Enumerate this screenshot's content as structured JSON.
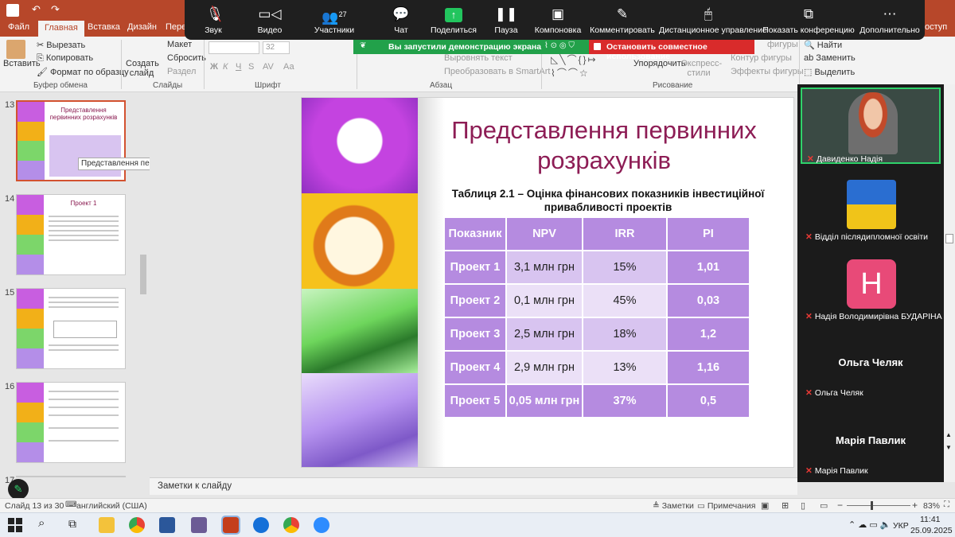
{
  "ribbon": {
    "tabs": [
      "Файл",
      "Главная",
      "Вставка",
      "Дизайн",
      "Пере",
      "оступ"
    ],
    "clipboard": {
      "paste": "Вставить",
      "cut": "Вырезать",
      "copy": "Копировать",
      "format": "Формат по образцу",
      "group": "Буфер обмена"
    },
    "slides": {
      "new": "Создать слайд",
      "layout": "Макет",
      "reset": "Сбросить",
      "section": "Раздел",
      "group": "Слайды"
    },
    "font": {
      "size": "32",
      "group": "Шрифт",
      "bold": "Ж",
      "italic": "К",
      "underline": "Ч",
      "strike": "З",
      "shadow": "S",
      "spacing": "AV",
      "case": "Аа"
    },
    "paragraph": {
      "align": "Выровнять текст",
      "smartart": "Преобразовать в SmartArt",
      "group": "Абзац"
    },
    "drawing": {
      "arrange": "Упорядочить",
      "styles": "Экспресс-стили",
      "outline": "Контур фигуры",
      "effects": "Эффекты фигуры",
      "fill": "фигуры",
      "group": "Рисование"
    },
    "editing": {
      "find": "Найти",
      "replace": "Заменить",
      "select": "Выделить"
    }
  },
  "zoom": {
    "buttons": [
      {
        "label": "Звук",
        "icon": "mic-muted-icon"
      },
      {
        "label": "Видео",
        "icon": "video-icon"
      },
      {
        "label": "Участники",
        "icon": "participants-icon",
        "count": "27"
      },
      {
        "label": "Чат",
        "icon": "chat-icon"
      },
      {
        "label": "Поделиться",
        "icon": "share-icon"
      },
      {
        "label": "Пауза",
        "icon": "pause-icon"
      },
      {
        "label": "Компоновка",
        "icon": "layout-icon"
      },
      {
        "label": "Комментировать",
        "icon": "pencil-icon"
      },
      {
        "label": "Дистанционное управление",
        "icon": "mouse-icon"
      },
      {
        "label": "Показать конференцию",
        "icon": "conference-icon"
      },
      {
        "label": "Дополнительно",
        "icon": "more-icon"
      }
    ],
    "share_banner": "Вы запустили демонстрацию экрана",
    "stop_banner": "Остановить совместное использование"
  },
  "thumbnails": [
    {
      "num": "13",
      "title": "Представлення первинних розрахунків",
      "selected": true
    },
    {
      "num": "14",
      "title": "Проект 1",
      "selected": false
    },
    {
      "num": "15",
      "title": "",
      "selected": false
    },
    {
      "num": "16",
      "title": "",
      "selected": false
    },
    {
      "num": "17",
      "title": "",
      "selected": false
    }
  ],
  "tooltip": "Представлення первинних роз...",
  "slide": {
    "title": "Представлення первинних розрахунків",
    "caption": "Таблиця 2.1 – Оцінка фінансових показників інвестиційної привабливості проектів",
    "table": {
      "headers": [
        "Показник",
        "NPV",
        "IRR",
        "PI"
      ],
      "rows": [
        [
          "Проект 1",
          "3,1 млн грн",
          "15%",
          "1,01"
        ],
        [
          "Проект 2",
          "0,1 млн грн",
          "45%",
          "0,03"
        ],
        [
          "Проект 3",
          "2,5 млн грн",
          "18%",
          "1,2"
        ],
        [
          "Проект 4",
          "2,9 млн грн",
          "13%",
          "1,16"
        ],
        [
          "Проект 5",
          "0,05 млн грн",
          "37%",
          "0,5"
        ]
      ]
    }
  },
  "participants": [
    {
      "name": "Давиденко Надія",
      "type": "video"
    },
    {
      "name": "Відділ післядипломної освіти",
      "type": "image"
    },
    {
      "name": "Надія Володимирівна БУДАРІНА ...",
      "type": "avatar",
      "initial": "H",
      "color": "#e84a78"
    },
    {
      "name": "Ольга Челяк",
      "type": "name"
    },
    {
      "name": "Марія Павлик",
      "type": "name"
    }
  ],
  "notes": "Заметки к слайду",
  "status": {
    "slide": "Слайд 13 из 30",
    "lang": "английский (США)",
    "notes_btn": "Заметки",
    "comments_btn": "Примечания",
    "zoom": "83%"
  },
  "taskbar": {
    "lang": "УКР",
    "time": "11:41",
    "date": "25.09.2025"
  }
}
